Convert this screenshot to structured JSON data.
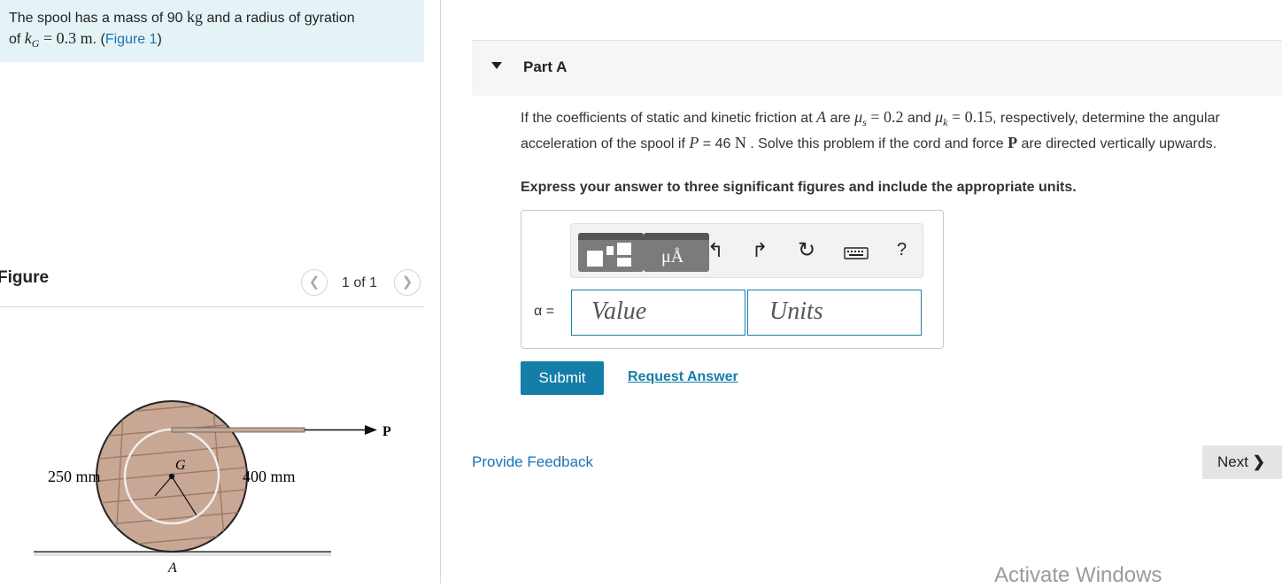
{
  "intro": {
    "line1_prefix": "The spool has a mass of 90 ",
    "mass_unit": "kg",
    "line1_suffix": " and a radius of gyration",
    "line2_prefix": "of ",
    "kG_expr": "k",
    "kG_sub": "G",
    "kG_value": " = 0.3 m",
    "line2_dot": ". (",
    "figure_link": "Figure 1",
    "line2_end": ")"
  },
  "figure_panel": {
    "title": "Figure",
    "counter": "1 of 1",
    "prev_icon": "chevron-left-icon",
    "next_icon": "chevron-right-icon",
    "labels": {
      "left_dim": "250 mm",
      "right_dim": "400 mm",
      "center": "G",
      "force": "P",
      "contact": "A"
    }
  },
  "part": {
    "label": "Part A",
    "question_1": "If the coefficients of static and kinetic friction at ",
    "point_A": "A",
    "question_2": " are ",
    "mu_s": "μ",
    "mu_s_sub": "s",
    "mu_s_val": " = 0.2",
    "question_3": " and ",
    "mu_k": "μ",
    "mu_k_sub": "k",
    "mu_k_val": " = 0.15",
    "question_4": ", respectively, determine the angular acceleration of the spool if ",
    "P_sym": "P",
    "P_val": " = 46 ",
    "P_unit": "N",
    "question_5": " . Solve this problem if the cord and force ",
    "P_bold": "P",
    "question_6": " are directed vertically upwards.",
    "instruction": "Express your answer to three significant figures and include the appropriate units."
  },
  "answer": {
    "variable_label": "α =",
    "value_placeholder": "Value",
    "units_placeholder": "Units",
    "toolbar": {
      "templates_icon": "templates-icon",
      "units_icon": "units-mu-angstrom-icon",
      "units_text": "μÅ",
      "undo_icon": "undo-icon",
      "redo_icon": "redo-icon",
      "reset_icon": "reset-icon",
      "keyboard_icon": "keyboard-icon",
      "help_text": "?"
    },
    "submit_label": "Submit",
    "request_label": "Request Answer"
  },
  "footer": {
    "feedback_label": "Provide Feedback",
    "next_label": "Next",
    "watermark": "Activate Windows"
  },
  "colors": {
    "accent": "#147ea8",
    "link": "#1a73b8",
    "intro_bg": "#e6f3f6"
  }
}
